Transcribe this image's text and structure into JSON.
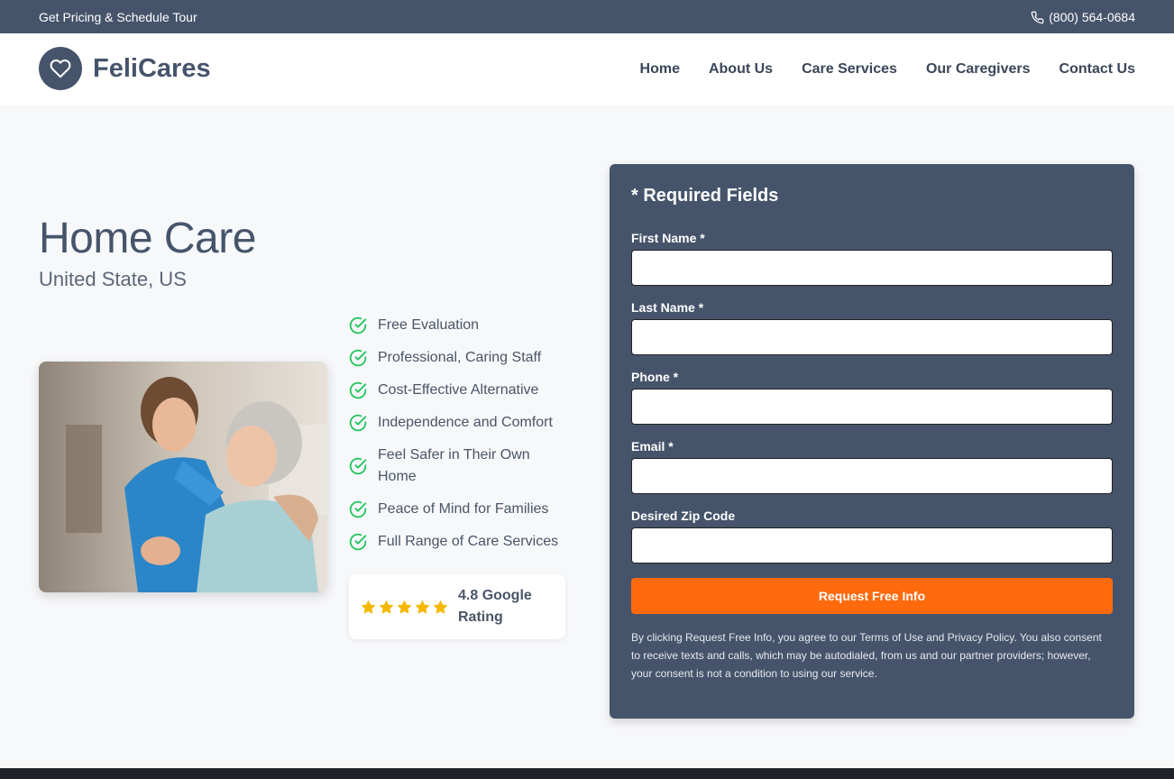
{
  "topbar": {
    "left_text": "Get Pricing & Schedule Tour",
    "phone": "(800) 564-0684"
  },
  "brand": {
    "name": "FeliCares"
  },
  "nav": {
    "items": [
      {
        "label": "Home"
      },
      {
        "label": "About Us"
      },
      {
        "label": "Care Services"
      },
      {
        "label": "Our Caregivers"
      },
      {
        "label": "Contact Us"
      }
    ]
  },
  "hero": {
    "title": "Home Care",
    "subtitle": "United State, US",
    "features": [
      {
        "label": "Free Evaluation"
      },
      {
        "label": "Professional, Caring Staff"
      },
      {
        "label": "Cost-Effective Alternative"
      },
      {
        "label": "Independence and Comfort"
      },
      {
        "label": "Feel Safer in Their Own Home"
      },
      {
        "label": "Peace of Mind for Families"
      },
      {
        "label": "Full Range of Care Services"
      }
    ],
    "rating": {
      "text": "4.8 Google Rating",
      "stars": 5
    }
  },
  "form": {
    "heading": "* Required Fields",
    "fields": [
      {
        "label": "First Name *",
        "value": ""
      },
      {
        "label": "Last Name *",
        "value": ""
      },
      {
        "label": "Phone *",
        "value": ""
      },
      {
        "label": "Email *",
        "value": ""
      },
      {
        "label": "Desired Zip Code",
        "value": ""
      }
    ],
    "submit_label": "Request Free Info",
    "disclaimer": "By clicking Request Free Info, you agree to our Terms of Use and Privacy Policy. You also consent to receive texts and calls, which may be autodialed, from us and our partner providers; however, your consent is not a condition to using our service."
  },
  "colors": {
    "primary": "#46546b",
    "accent": "#ff6a0d",
    "check": "#22c55e",
    "star": "#f5b800"
  },
  "icons": [
    "phone-icon",
    "heart-icon",
    "check-circle-icon",
    "star-icon"
  ]
}
